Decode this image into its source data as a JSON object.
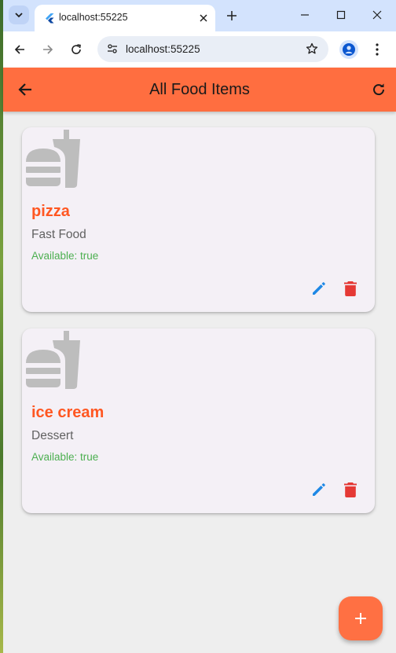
{
  "browser": {
    "tab_title": "localhost:55225",
    "url": "localhost:55225"
  },
  "appbar": {
    "title": "All Food Items"
  },
  "food_items": [
    {
      "name": "pizza",
      "category": "Fast Food",
      "availability": "Available: true"
    },
    {
      "name": "ice cream",
      "category": "Dessert",
      "availability": "Available: true"
    }
  ],
  "icons": {
    "food_placeholder": "fastfood-icon",
    "edit": "edit-icon",
    "delete": "delete-icon",
    "back": "arrow-back-icon",
    "refresh": "refresh-icon",
    "add": "add-icon"
  },
  "colors": {
    "appbar": "#ff6e40",
    "item_name": "#ff5722",
    "available": "#4caf50",
    "edit": "#1e88e5",
    "delete": "#e53935",
    "fab": "#ff7043"
  }
}
